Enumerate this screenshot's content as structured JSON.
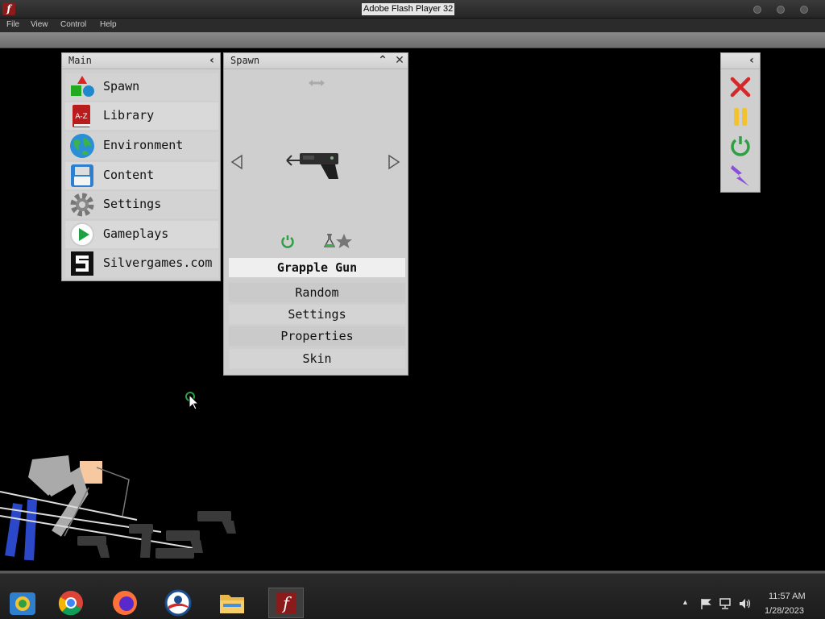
{
  "window": {
    "title": "Adobe Flash Player 32"
  },
  "menubar": {
    "items": [
      "File",
      "View",
      "Control",
      "Help"
    ]
  },
  "main_panel": {
    "title": "Main",
    "items": [
      {
        "label": "Spawn",
        "icon": "shapes-icon"
      },
      {
        "label": "Library",
        "icon": "book-az-icon"
      },
      {
        "label": "Environment",
        "icon": "globe-icon"
      },
      {
        "label": "Content",
        "icon": "floppy-disk-icon"
      },
      {
        "label": "Settings",
        "icon": "gear-icon"
      },
      {
        "label": "Gameplays",
        "icon": "play-icon"
      },
      {
        "label": "Silvergames.com",
        "icon": "silvergames-logo-icon"
      }
    ]
  },
  "spawn_panel": {
    "title": "Spawn",
    "selected_item": "Grapple Gun",
    "options": [
      "Random",
      "Settings",
      "Properties",
      "Skin"
    ]
  },
  "side_toolbar": {
    "tools": [
      "close-x-icon",
      "pause-icon",
      "power-icon",
      "lightning-icon"
    ]
  },
  "taskbar": {
    "apps": [
      "windows-explorer-icon",
      "chrome-icon",
      "firefox-icon",
      "obama-logo-icon",
      "file-explorer-icon",
      "flash-player-icon"
    ],
    "time": "11:57 AM",
    "date": "1/28/2023"
  },
  "colors": {
    "panel_bg": "#cfcfcf",
    "flash_red": "#8b1a1a",
    "accent_green": "#2ea043",
    "pause_yellow": "#f2c230",
    "lightning_purple": "#8a4fd8"
  }
}
